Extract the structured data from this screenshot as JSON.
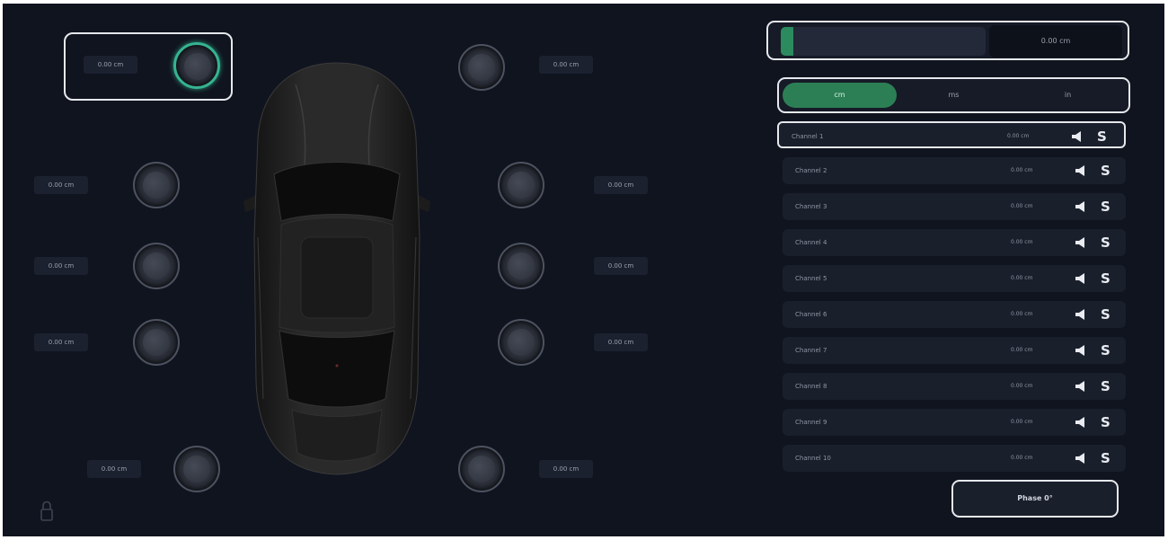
{
  "speakers": {
    "front_left_label": "0.00 cm",
    "front_right_label": "0.00 cm",
    "left_1_label": "0.00 cm",
    "left_2_label": "0.00 cm",
    "left_3_label": "0.00 cm",
    "right_1_label": "0.00 cm",
    "right_2_label": "0.00 cm",
    "right_3_label": "0.00 cm",
    "rear_left_label": "0.00 cm",
    "rear_right_label": "0.00 cm"
  },
  "delay": {
    "value": "0.00 cm",
    "level_fraction": 0.06
  },
  "segments": [
    "cm",
    "ms",
    "in"
  ],
  "channels": [
    {
      "name": "Channel 1",
      "value": "0.00 cm"
    },
    {
      "name": "Channel 2",
      "value": "0.00 cm"
    },
    {
      "name": "Channel 3",
      "value": "0.00 cm"
    },
    {
      "name": "Channel 4",
      "value": "0.00 cm"
    },
    {
      "name": "Channel 5",
      "value": "0.00 cm"
    },
    {
      "name": "Channel 6",
      "value": "0.00 cm"
    },
    {
      "name": "Channel 7",
      "value": "0.00 cm"
    },
    {
      "name": "Channel 8",
      "value": "0.00 cm"
    },
    {
      "name": "Channel 9",
      "value": "0.00 cm"
    },
    {
      "name": "Channel 10",
      "value": "0.00 cm"
    }
  ],
  "solo_label": "S",
  "phase_button": "Phase 0°",
  "colors": {
    "background": "#10141f",
    "accent_green": "#2c7f55",
    "active_ring": "#36b491"
  },
  "icons": {
    "mute": "speaker-icon",
    "lock": "lock-icon"
  }
}
